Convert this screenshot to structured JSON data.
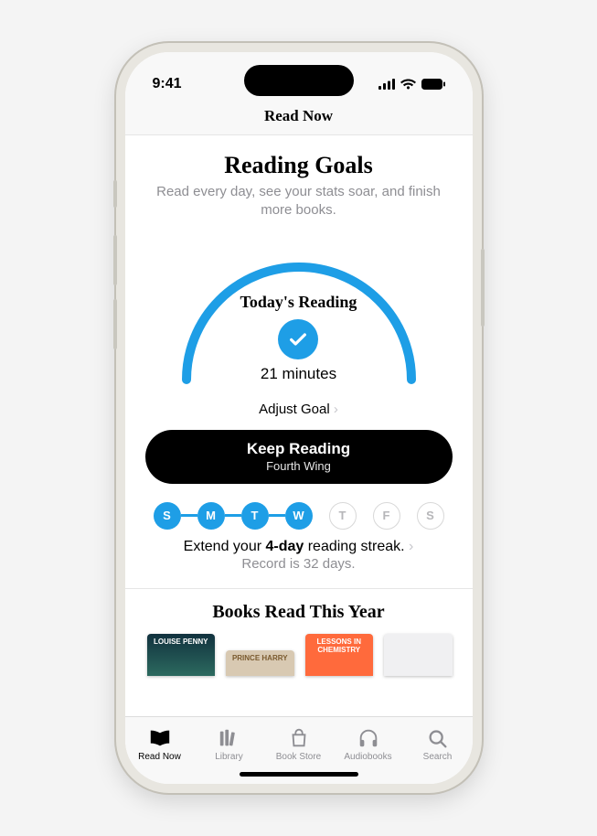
{
  "status": {
    "time": "9:41"
  },
  "header": {
    "title": "Read Now"
  },
  "goals": {
    "title": "Reading Goals",
    "subtitle": "Read every day, see your stats soar, and finish more books.",
    "today_label": "Today's Reading",
    "minutes_text": "21 minutes",
    "adjust_label": "Adjust Goal",
    "keep_reading_label": "Keep Reading",
    "keep_reading_book": "Fourth Wing"
  },
  "streak": {
    "days": [
      {
        "letter": "S",
        "complete": true
      },
      {
        "letter": "M",
        "complete": true
      },
      {
        "letter": "T",
        "complete": true
      },
      {
        "letter": "W",
        "complete": true
      },
      {
        "letter": "T",
        "complete": false
      },
      {
        "letter": "F",
        "complete": false
      },
      {
        "letter": "S",
        "complete": false
      }
    ],
    "extend_prefix": "Extend your ",
    "extend_bold": "4-day",
    "extend_suffix": " reading streak.",
    "record_text": "Record is 32 days."
  },
  "books_year": {
    "title": "Books Read This Year",
    "covers": [
      "LOUISE PENNY",
      "PRINCE HARRY",
      "LESSONS IN CHEMISTRY",
      ""
    ]
  },
  "tabs": {
    "items": [
      {
        "label": "Read Now"
      },
      {
        "label": "Library"
      },
      {
        "label": "Book Store"
      },
      {
        "label": "Audiobooks"
      },
      {
        "label": "Search"
      }
    ]
  }
}
